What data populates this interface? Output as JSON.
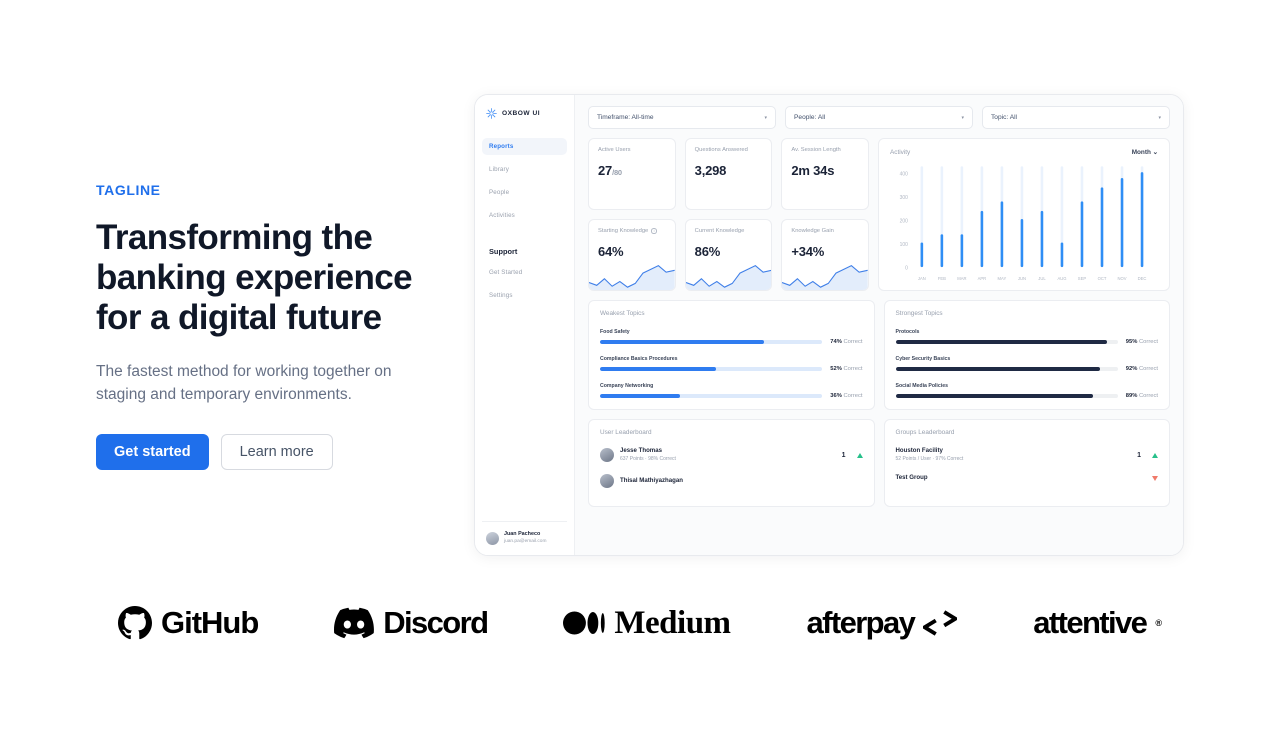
{
  "hero": {
    "tagline": "TAGLINE",
    "headline": "Transforming the banking experience for a digital future",
    "subhead": "The fastest method for working together on staging and temporary environments.",
    "primary_button": "Get started",
    "secondary_button": "Learn more",
    "accent_color": "#1f6feb"
  },
  "dashboard": {
    "sidebar": {
      "brand": "OXBOW UI",
      "items": [
        {
          "label": "Reports",
          "active": true
        },
        {
          "label": "Library",
          "active": false
        },
        {
          "label": "People",
          "active": false
        },
        {
          "label": "Activities",
          "active": false
        }
      ],
      "section_heading": "Support",
      "support_items": [
        {
          "label": "Get Started"
        },
        {
          "label": "Settings"
        }
      ],
      "user": {
        "name": "Juan Pacheco",
        "email": "juan.pa@email.com"
      }
    },
    "filters": [
      {
        "label": "Timeframe: All-time"
      },
      {
        "label": "People: All"
      },
      {
        "label": "Topic: All"
      }
    ],
    "kpis": [
      {
        "label": "Active Users",
        "value": "27",
        "suffix": "/80",
        "info": false
      },
      {
        "label": "Questions Answered",
        "value": "3,298",
        "suffix": "",
        "info": false
      },
      {
        "label": "Av. Session Length",
        "value": "2m 34s",
        "suffix": "",
        "info": false
      },
      {
        "label": "Starting Knowledge",
        "value": "64%",
        "suffix": "",
        "info": true
      },
      {
        "label": "Current Knowledge",
        "value": "86%",
        "suffix": "",
        "info": false
      },
      {
        "label": "Knowledge Gain",
        "value": "+34%",
        "suffix": "",
        "info": false
      }
    ],
    "activity": {
      "title": "Activity",
      "range_selector": "Month",
      "caret": "⌄"
    },
    "weakest_topics": {
      "title": "Weakest Topics",
      "suffix": "Correct",
      "rows": [
        {
          "name": "Food Safety",
          "pct": "74%",
          "value": 74
        },
        {
          "name": "Compliance Basics Procedures",
          "pct": "52%",
          "value": 52
        },
        {
          "name": "Company Networking",
          "pct": "36%",
          "value": 36
        }
      ]
    },
    "strongest_topics": {
      "title": "Strongest Topics",
      "suffix": "Correct",
      "rows": [
        {
          "name": "Protocols",
          "pct": "95%",
          "value": 95
        },
        {
          "name": "Cyber Security Basics",
          "pct": "92%",
          "value": 92
        },
        {
          "name": "Social Media Policies",
          "pct": "89%",
          "value": 89
        }
      ]
    },
    "user_leaderboard": {
      "title": "User Leaderboard",
      "rows": [
        {
          "name": "Jesse Thomas",
          "meta": "637 Points · 98% Correct",
          "rank": "1",
          "trend": "up"
        },
        {
          "name": "Thisal Mathiyazhagan",
          "meta": "",
          "rank": "",
          "trend": "up"
        }
      ]
    },
    "groups_leaderboard": {
      "title": "Groups Leaderboard",
      "rows": [
        {
          "name": "Houston Facility",
          "meta": "52 Points / User · 97% Correct",
          "rank": "1",
          "trend": "up"
        },
        {
          "name": "Test Group",
          "meta": "",
          "rank": "",
          "trend": "down"
        }
      ]
    }
  },
  "chart_data": {
    "type": "bar",
    "title": "Activity",
    "categories": [
      "JAN",
      "FEB",
      "MAR",
      "APR",
      "MAY",
      "JUN",
      "JUL",
      "AUG",
      "SEP",
      "OCT",
      "NOV",
      "DEC"
    ],
    "values": [
      105,
      140,
      140,
      240,
      280,
      205,
      240,
      105,
      280,
      340,
      380,
      405
    ],
    "ytick_labels": [
      "400",
      "300",
      "200",
      "100",
      "0"
    ],
    "yticks": [
      400,
      300,
      200,
      100,
      0
    ],
    "ylim": [
      0,
      430
    ],
    "xlabel": "",
    "ylabel": "",
    "grid": false,
    "legend": "none",
    "bar_color": "#2f8ef5",
    "track_color": "#eaf2fd"
  },
  "sparkline_data": {
    "type": "area",
    "points": [
      18,
      12,
      20,
      9,
      15,
      8,
      13,
      22,
      26,
      30,
      24,
      26
    ],
    "color": "#3f7fe8",
    "fill": "#dfeafb"
  },
  "logos": [
    {
      "name": "GitHub",
      "icon": "github-icon"
    },
    {
      "name": "Discord",
      "icon": "discord-icon"
    },
    {
      "name": "Medium",
      "icon": "medium-icon"
    },
    {
      "name": "afterpay",
      "icon": "afterpay-icon"
    },
    {
      "name": "attentive",
      "icon": "attentive-icon",
      "sup": "®"
    }
  ]
}
